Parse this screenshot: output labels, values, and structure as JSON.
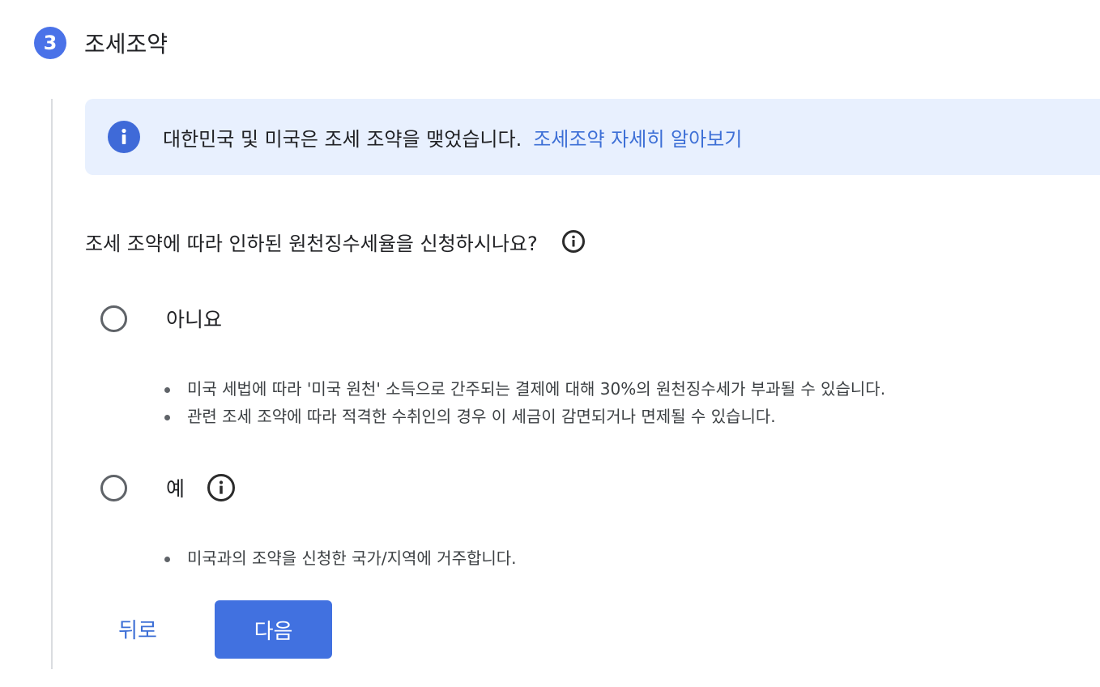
{
  "step": {
    "number": "3",
    "title": "조세조약"
  },
  "banner": {
    "icon": "info-icon",
    "text": "대한민국 및 미국은 조세 조약을 맺었습니다.",
    "link": "조세조약 자세히 알아보기"
  },
  "question": {
    "text": "조세 조약에 따라 인하된 원천징수세율을 신청하시나요?",
    "icon": "info-outline-icon"
  },
  "options": [
    {
      "label": "아니요",
      "selected": false,
      "bullets": [
        "미국 세법에 따라 '미국 원천' 소득으로 간주되는 결제에 대해 30%의 원천징수세가 부과될 수 있습니다.",
        "관련 조세 조약에 따라 적격한 수취인의 경우 이 세금이 감면되거나 면제될 수 있습니다."
      ]
    },
    {
      "label": "예",
      "selected": false,
      "bullets": [
        "미국과의 조약을 신청한 국가/지역에 거주합니다."
      ]
    }
  ],
  "buttons": {
    "back": "뒤로",
    "next": "다음"
  },
  "colors": {
    "accent": "#4171e0",
    "link": "#3d6fd6",
    "banner_bg": "#e8f0fe"
  }
}
